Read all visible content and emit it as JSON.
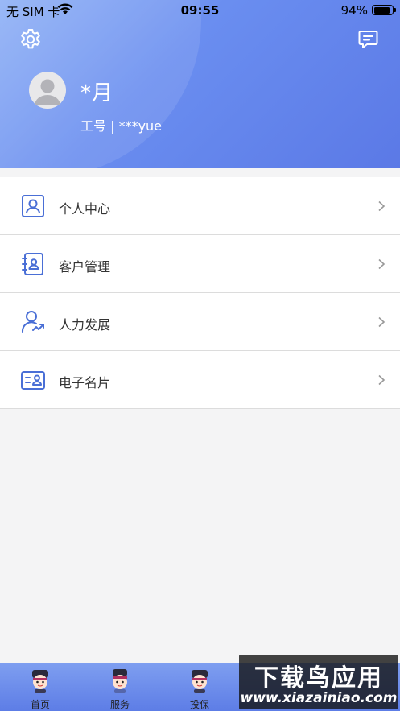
{
  "status_bar": {
    "carrier": "无 SIM 卡",
    "time": "09:55",
    "battery": "94%"
  },
  "header": {
    "icons": [
      "gear-icon",
      "message-icon"
    ],
    "username": "*月",
    "employee_id": "工号 | ***yue"
  },
  "menu": {
    "items": [
      {
        "label": "个人中心",
        "icon": "person-card-icon"
      },
      {
        "label": "客户管理",
        "icon": "contacts-book-icon"
      },
      {
        "label": "人力发展",
        "icon": "person-growth-icon"
      },
      {
        "label": "电子名片",
        "icon": "business-card-icon"
      }
    ]
  },
  "tabbar": {
    "tabs": [
      {
        "label": "首页"
      },
      {
        "label": "服务"
      },
      {
        "label": "投保"
      }
    ]
  },
  "watermark": {
    "title": "下载鸟应用",
    "url": "www.xiazainiao.com"
  },
  "colors": {
    "header_start": "#8fb1f5",
    "header_end": "#5b79e6",
    "icon_accent": "#4a6fd6",
    "divider": "#dcdcdc"
  }
}
